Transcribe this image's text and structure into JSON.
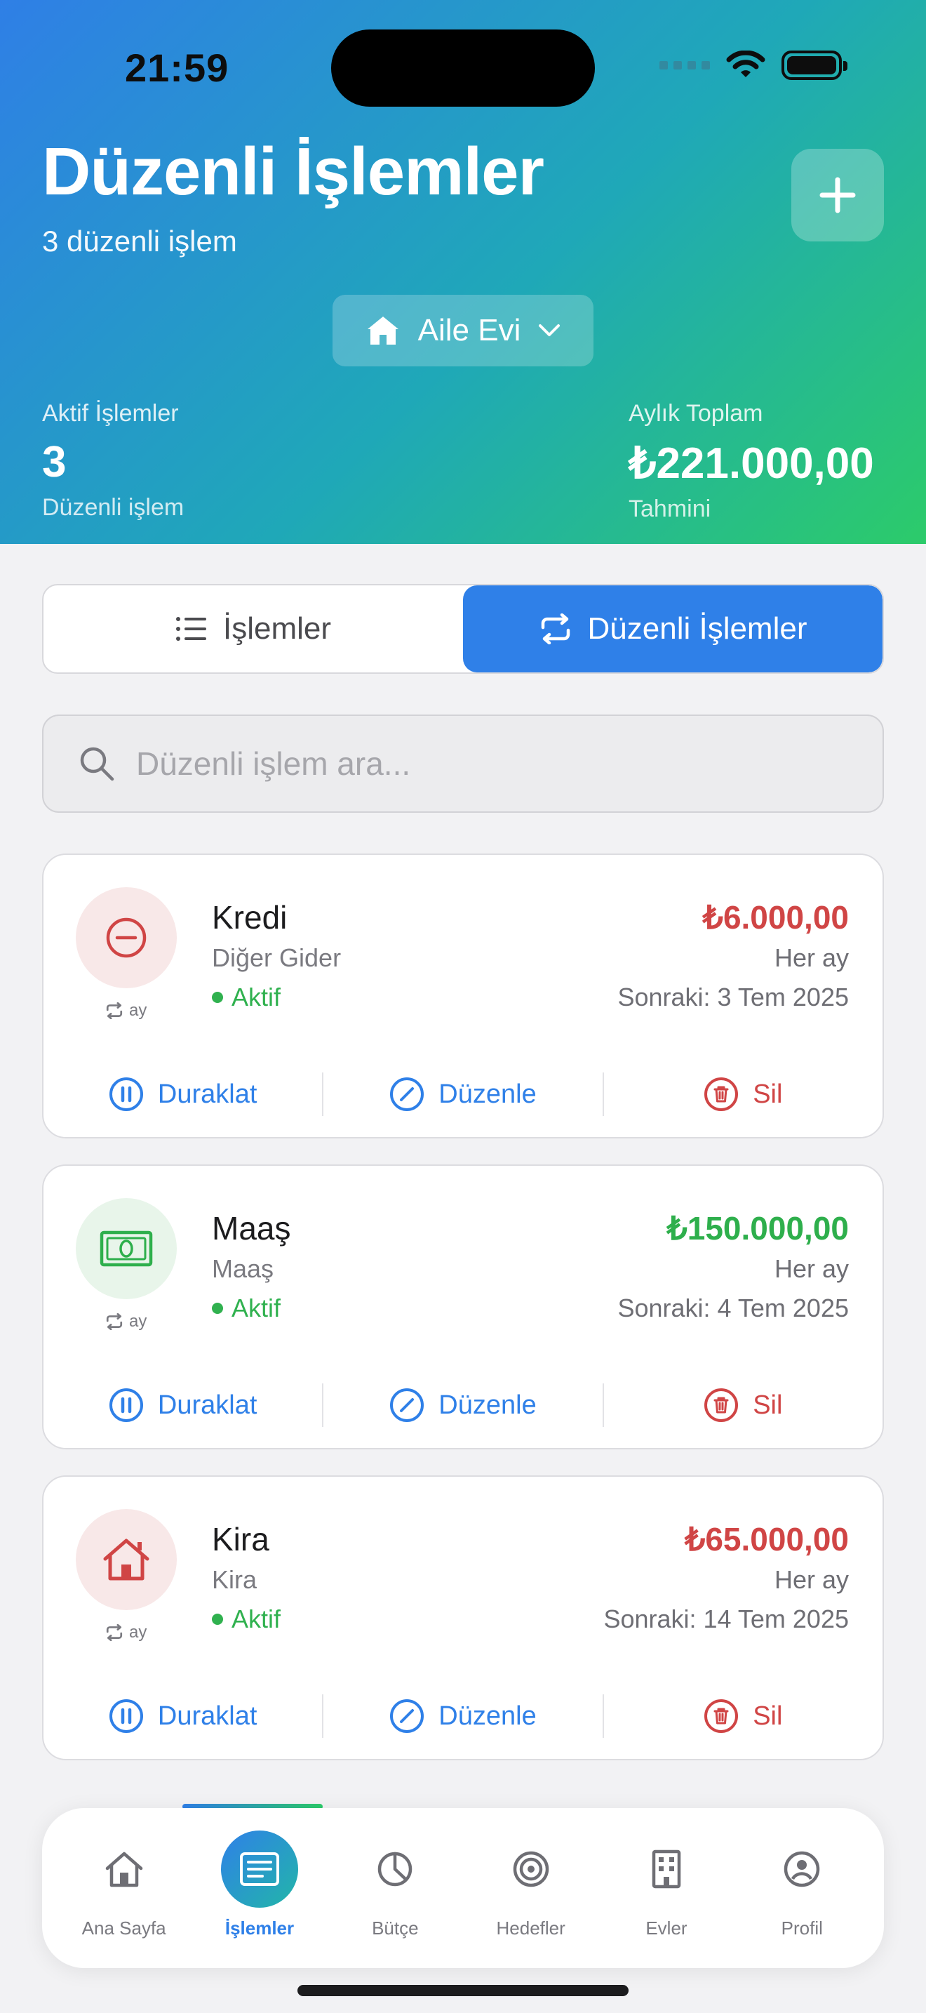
{
  "status_bar": {
    "time": "21:59"
  },
  "header": {
    "title": "Düzenli İşlemler",
    "subtitle": "3 düzenli işlem",
    "home_selector": "Aile Evi",
    "stats": {
      "left": {
        "label": "Aktif İşlemler",
        "value": "3",
        "sub": "Düzenli işlem"
      },
      "right": {
        "label": "Aylık Toplam",
        "value": "₺221.000,00",
        "sub": "Tahmini"
      }
    }
  },
  "segments": [
    {
      "label": "İşlemler",
      "icon": "list-icon",
      "active": false
    },
    {
      "label": "Düzenli İşlemler",
      "icon": "repeat-icon",
      "active": true
    }
  ],
  "search": {
    "placeholder": "Düzenli işlem ara..."
  },
  "transactions": [
    {
      "name": "Kredi",
      "category": "Diğer Gider",
      "status": "Aktif",
      "amount": "₺6.000,00",
      "type": "expense",
      "period": "Her ay",
      "next": "Sonraki: 3 Tem 2025",
      "freq": "ay",
      "icon": "minus-circle-icon"
    },
    {
      "name": "Maaş",
      "category": "Maaş",
      "status": "Aktif",
      "amount": "₺150.000,00",
      "type": "income",
      "period": "Her ay",
      "next": "Sonraki: 4 Tem 2025",
      "freq": "ay",
      "icon": "banknote-icon"
    },
    {
      "name": "Kira",
      "category": "Kira",
      "status": "Aktif",
      "amount": "₺65.000,00",
      "type": "expense",
      "period": "Her ay",
      "next": "Sonraki: 14 Tem 2025",
      "freq": "ay",
      "icon": "house-icon"
    }
  ],
  "actions": {
    "pause": "Duraklat",
    "edit": "Düzenle",
    "delete": "Sil"
  },
  "tabbar": [
    {
      "label": "Ana Sayfa",
      "icon": "home-icon"
    },
    {
      "label": "İşlemler",
      "icon": "receipt-icon",
      "active": true
    },
    {
      "label": "Bütçe",
      "icon": "pie-chart-icon"
    },
    {
      "label": "Hedefler",
      "icon": "target-icon"
    },
    {
      "label": "Evler",
      "icon": "building-icon"
    },
    {
      "label": "Profil",
      "icon": "profile-icon"
    }
  ],
  "colors": {
    "accent": "#2f80e8",
    "income": "#2eaf4c",
    "expense": "#d04545",
    "gradient_start": "#2f7fe6",
    "gradient_end": "#2ccb6a"
  }
}
